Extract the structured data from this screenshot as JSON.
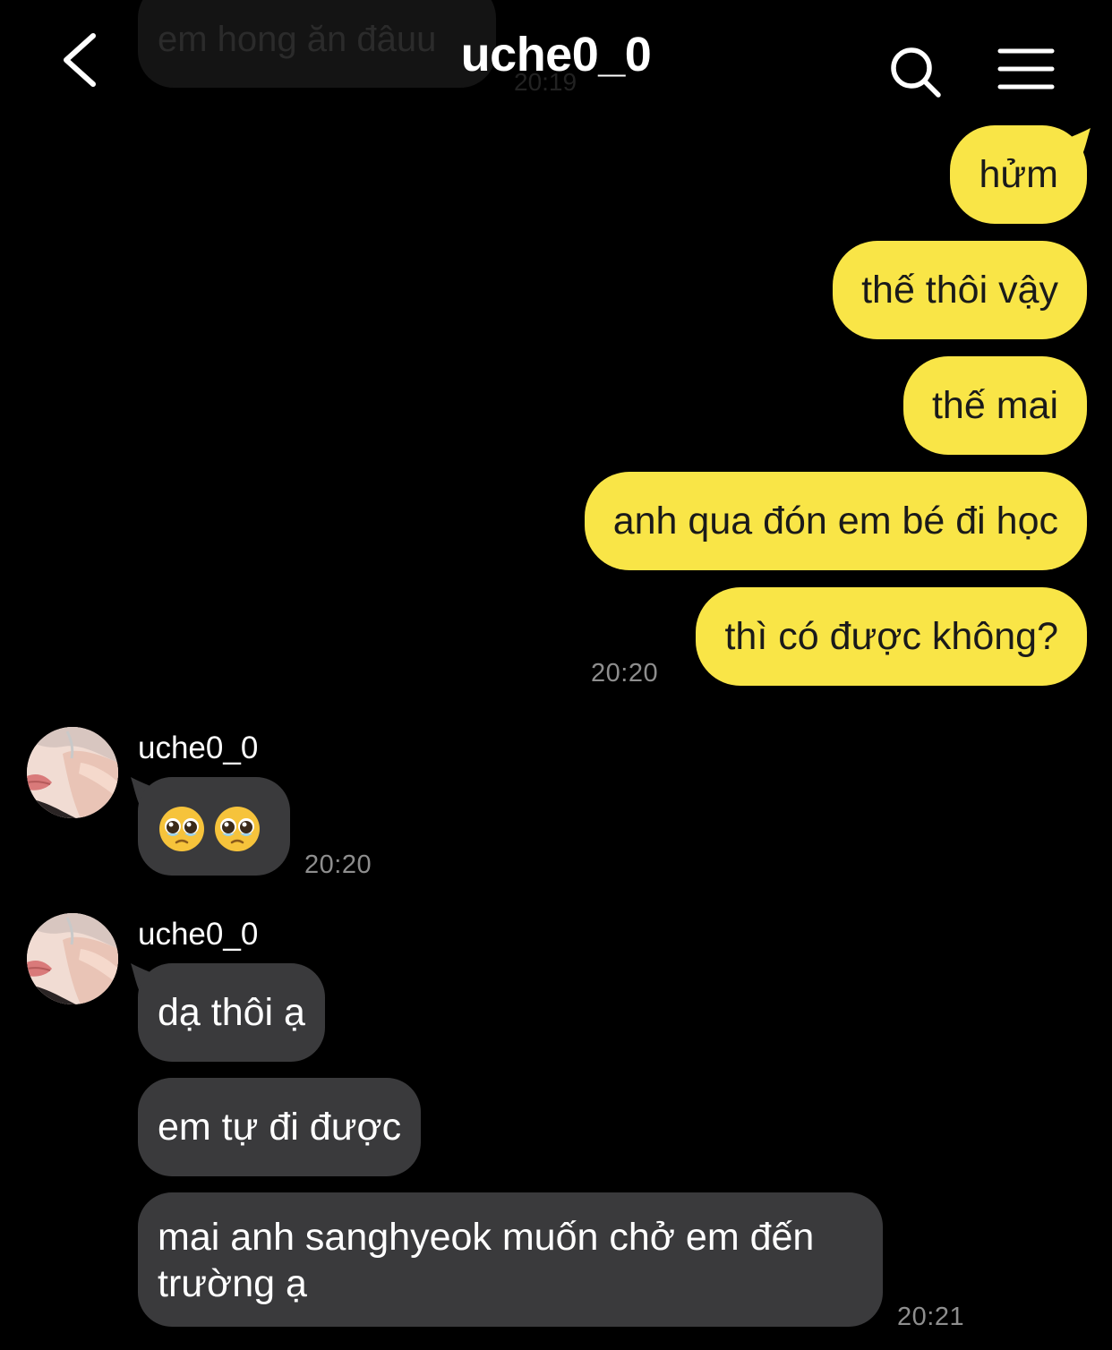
{
  "header": {
    "title": "uche0_0",
    "back_icon": "chevron-left-icon",
    "search_icon": "search-icon",
    "menu_icon": "hamburger-menu-icon"
  },
  "ghost_message": {
    "text": "em hong ăn đâuu",
    "time": "20:19"
  },
  "outgoing": {
    "messages": [
      "hửm",
      "thế thôi vậy",
      "thế mai",
      "anh qua đón em bé đi học",
      "thì có được không?"
    ],
    "time": "20:20"
  },
  "incoming_groups": [
    {
      "sender": "uche0_0",
      "messages": [
        "🥹🥹"
      ],
      "time": "20:20"
    },
    {
      "sender": "uche0_0",
      "messages": [
        "dạ thôi ạ",
        "em tự đi được",
        "mai anh sanghyeok muốn chở em đến trường ạ"
      ],
      "time": "20:21"
    }
  ],
  "colors": {
    "background": "#000000",
    "outgoing_bubble": "#f9e547",
    "incoming_bubble": "#3a3a3c",
    "timestamp": "#8e8e8e"
  }
}
